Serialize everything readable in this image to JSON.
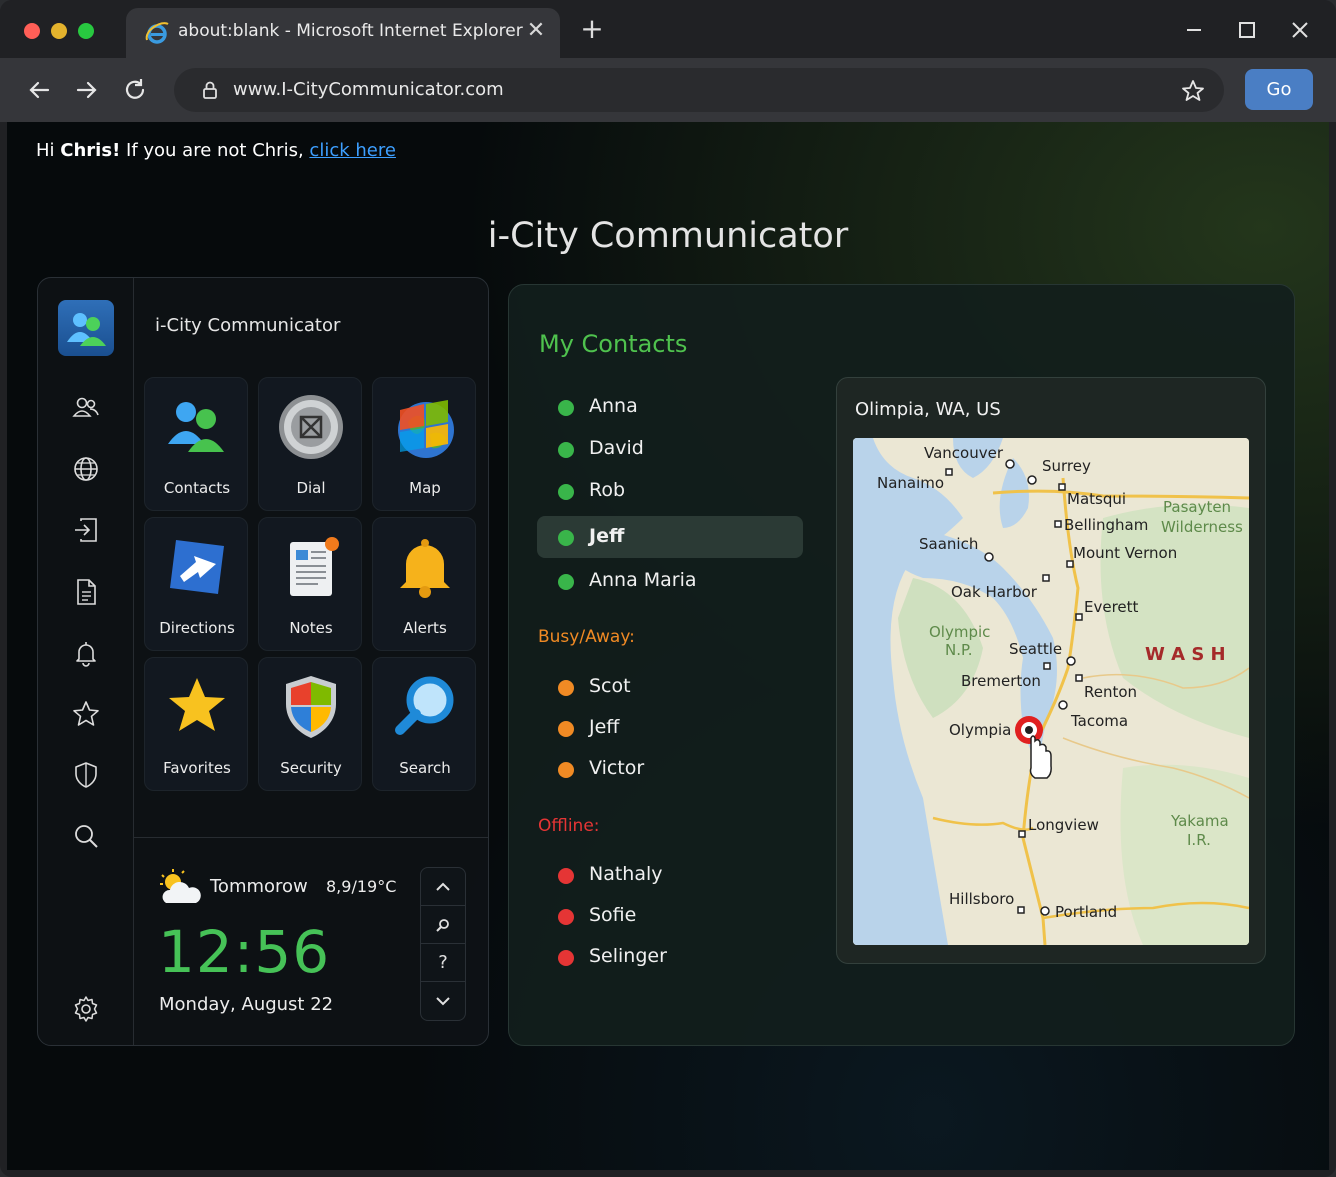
{
  "browser": {
    "tab_title": "about:blank - Microsoft Internet Explorer",
    "url": "www.I-CityCommunicator.com",
    "go_label": "Go",
    "accent": "#4a7ec4"
  },
  "greeting": {
    "prefix": "Hi",
    "name": "Chris!",
    "middle": "If you are not Chris,",
    "link": "click here"
  },
  "page_title": "i-City Communicator",
  "left_panel": {
    "header": "i-City Communicator",
    "sidebar_icons": [
      "contacts-icon",
      "globe-icon",
      "sign-in-icon",
      "document-icon",
      "bell-icon",
      "star-icon",
      "shield-icon",
      "search-icon",
      "settings-icon"
    ],
    "tiles": [
      {
        "label": "Contacts",
        "icon": "contacts-icon"
      },
      {
        "label": "Dial",
        "icon": "dial-icon"
      },
      {
        "label": "Map",
        "icon": "map-globe-icon"
      },
      {
        "label": "Directions",
        "icon": "directions-arrow-icon"
      },
      {
        "label": "Notes",
        "icon": "notes-icon"
      },
      {
        "label": "Alerts",
        "icon": "bell-icon"
      },
      {
        "label": "Favorites",
        "icon": "star-icon"
      },
      {
        "label": "Security",
        "icon": "shield-icon"
      },
      {
        "label": "Search",
        "icon": "magnifier-icon"
      }
    ],
    "weather": {
      "day": "Tommorow",
      "temp": "8,9/19°C",
      "icon": "partly-cloudy-icon",
      "time": "12:56",
      "date": "Monday, August 22",
      "controls": [
        "chevron-up-icon",
        "zoom-icon",
        "?",
        "chevron-down-icon"
      ]
    }
  },
  "contacts": {
    "title": "My Contacts",
    "online": [
      "Anna",
      "David",
      "Rob",
      "Jeff",
      "Anna Maria"
    ],
    "selected": "Jeff",
    "busy_label": "Busy/Away:",
    "busy": [
      "Scot",
      "Jeff",
      "Victor"
    ],
    "offline_label": "Offline:",
    "offline": [
      "Nathaly",
      "Sofie",
      "Selinger"
    ],
    "colors": {
      "online": "#39b54a",
      "busy": "#f08a24",
      "offline": "#e53535"
    }
  },
  "map": {
    "title": "Olimpia, WA, US",
    "places": [
      "Vancouver",
      "Surrey",
      "Nanaimo",
      "Matsqui",
      "Pasayten Wilderness",
      "Bellingham",
      "Saanich",
      "Mount Vernon",
      "Oak Harbor",
      "Everett",
      "Olympic N.P.",
      "Seattle",
      "W A S H",
      "Bremerton",
      "Renton",
      "Olympia",
      "Tacoma",
      "Longview",
      "Yakama I.R.",
      "Hillsboro",
      "Portland"
    ],
    "pin": "location-pin-icon"
  }
}
